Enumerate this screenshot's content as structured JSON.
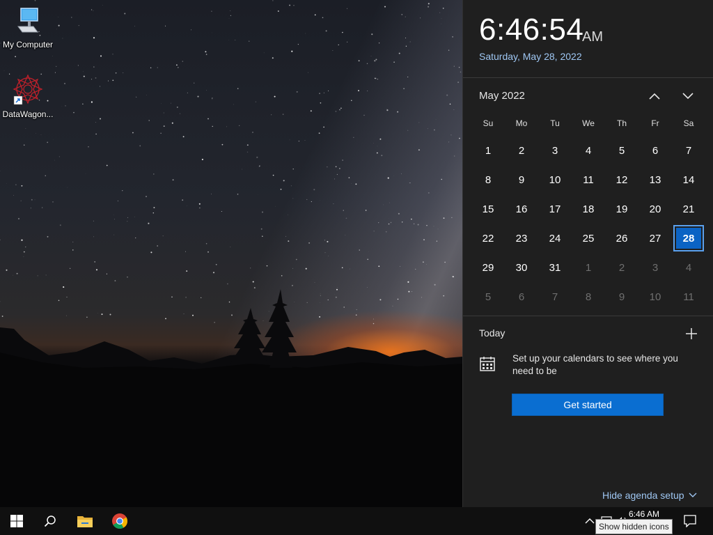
{
  "desktop": {
    "icons": [
      {
        "label": "My Computer",
        "icon": "computer-icon"
      },
      {
        "label": "DataWagon...",
        "icon": "datawagon-shortcut-icon"
      }
    ]
  },
  "flyout": {
    "time": "6:46:54",
    "ampm": "AM",
    "date": "Saturday, May 28, 2022",
    "month_label": "May 2022",
    "weekdays": [
      "Su",
      "Mo",
      "Tu",
      "We",
      "Th",
      "Fr",
      "Sa"
    ],
    "days": [
      {
        "n": "1",
        "m": false
      },
      {
        "n": "2",
        "m": false
      },
      {
        "n": "3",
        "m": false
      },
      {
        "n": "4",
        "m": false
      },
      {
        "n": "5",
        "m": false
      },
      {
        "n": "6",
        "m": false
      },
      {
        "n": "7",
        "m": false
      },
      {
        "n": "8",
        "m": false
      },
      {
        "n": "9",
        "m": false
      },
      {
        "n": "10",
        "m": false
      },
      {
        "n": "11",
        "m": false
      },
      {
        "n": "12",
        "m": false
      },
      {
        "n": "13",
        "m": false
      },
      {
        "n": "14",
        "m": false
      },
      {
        "n": "15",
        "m": false
      },
      {
        "n": "16",
        "m": false
      },
      {
        "n": "17",
        "m": false
      },
      {
        "n": "18",
        "m": false
      },
      {
        "n": "19",
        "m": false
      },
      {
        "n": "20",
        "m": false
      },
      {
        "n": "21",
        "m": false
      },
      {
        "n": "22",
        "m": false
      },
      {
        "n": "23",
        "m": false
      },
      {
        "n": "24",
        "m": false
      },
      {
        "n": "25",
        "m": false
      },
      {
        "n": "26",
        "m": false
      },
      {
        "n": "27",
        "m": false
      },
      {
        "n": "28",
        "m": false,
        "today": true
      },
      {
        "n": "29",
        "m": false
      },
      {
        "n": "30",
        "m": false
      },
      {
        "n": "31",
        "m": false
      },
      {
        "n": "1",
        "m": true
      },
      {
        "n": "2",
        "m": true
      },
      {
        "n": "3",
        "m": true
      },
      {
        "n": "4",
        "m": true
      },
      {
        "n": "5",
        "m": true
      },
      {
        "n": "6",
        "m": true
      },
      {
        "n": "7",
        "m": true
      },
      {
        "n": "8",
        "m": true
      },
      {
        "n": "9",
        "m": true
      },
      {
        "n": "10",
        "m": true
      },
      {
        "n": "11",
        "m": true
      }
    ],
    "today_label": "Today",
    "agenda_message": "Set up your calendars to see where you need to be",
    "get_started_label": "Get started",
    "hide_agenda_label": "Hide agenda setup"
  },
  "taskbar": {
    "buttons": [
      "start-icon",
      "search-icon",
      "file-explorer-icon",
      "chrome-icon"
    ],
    "tray_time": "6:46 AM",
    "tooltip": "Show hidden icons"
  },
  "colors": {
    "accent": "#0a6ed1",
    "today_border": "#5aa0ee",
    "date_text": "#9fc7f3",
    "flyout_bg": "#1f1f1f",
    "taskbar_bg": "#101010"
  }
}
